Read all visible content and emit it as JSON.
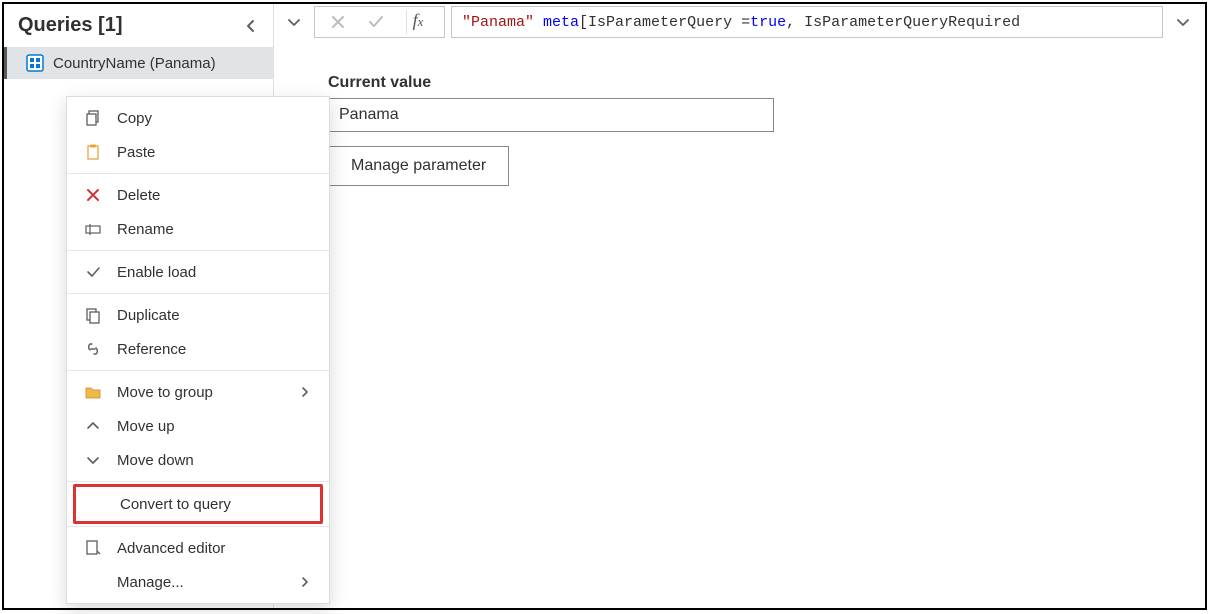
{
  "queries": {
    "title": "Queries [1]",
    "items": [
      {
        "label": "CountryName (Panama)"
      }
    ]
  },
  "contextMenu": {
    "copy": "Copy",
    "paste": "Paste",
    "delete": "Delete",
    "rename": "Rename",
    "enableLoad": "Enable load",
    "duplicate": "Duplicate",
    "reference": "Reference",
    "moveToGroup": "Move to group",
    "moveUp": "Move up",
    "moveDown": "Move down",
    "convertToQuery": "Convert to query",
    "advancedEditor": "Advanced editor",
    "manage": "Manage..."
  },
  "formula": {
    "str": "\"Panama\"",
    "kw": "meta",
    "rest": " [IsParameterQuery = ",
    "trueKw": "true",
    "rest2": ", IsParameterQueryRequired"
  },
  "panel": {
    "currentValueLabel": "Current value",
    "currentValue": "Panama",
    "manageButton": "Manage parameter"
  }
}
